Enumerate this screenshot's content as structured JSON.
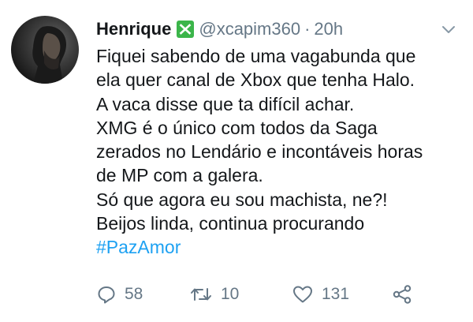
{
  "tweet": {
    "author_name": "Henrique",
    "handle": "@xcapim360",
    "separator": "·",
    "time": "20h",
    "lines": [
      "Fiquei sabendo de uma vagabunda que",
      "ela quer canal de Xbox que tenha Halo.",
      "A vaca disse que ta difícil achar.",
      "XMG é o único com todos da Saga",
      "zerados no Lendário e incontáveis horas",
      "de MP com a galera.",
      "Só que agora eu sou machista, ne?!",
      "Beijos linda, continua procurando"
    ],
    "hashtag": "#PazAmor",
    "replies": "58",
    "retweets": "10",
    "likes": "131"
  },
  "icons": {
    "verified": "check-box-icon",
    "menu": "chevron-down-icon",
    "reply": "reply-icon",
    "retweet": "retweet-icon",
    "like": "heart-icon",
    "share": "share-icon"
  },
  "colors": {
    "text": "#14171a",
    "muted": "#657786",
    "hashtag": "#1da1f2",
    "verified": "#3bb54a"
  }
}
